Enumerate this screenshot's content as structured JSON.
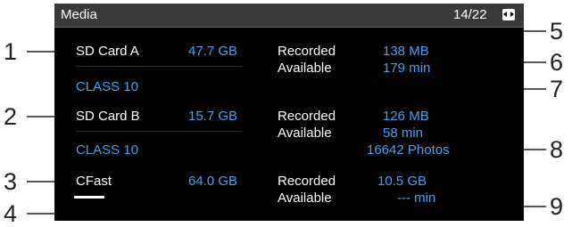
{
  "header": {
    "title": "Media",
    "page": "14/22",
    "nav_icon": "page-arrows-icon"
  },
  "media": [
    {
      "name": "SD Card A",
      "capacity": "47.7 GB",
      "class": "CLASS 10",
      "recorded_label": "Recorded",
      "recorded": "138 MB",
      "available_label": "Available",
      "available": "179 min"
    },
    {
      "name": "SD Card B",
      "capacity": "15.7 GB",
      "class": "CLASS 10",
      "recorded_label": "Recorded",
      "recorded": "126 MB",
      "available_label": "Available",
      "available": "58 min",
      "photos": "16642 Photos"
    },
    {
      "name": "CFast",
      "capacity": "64.0 GB",
      "recorded_label": "Recorded",
      "recorded": "10.5 GB",
      "available_label": "Available",
      "available": "--- min"
    }
  ],
  "callouts": [
    "1",
    "2",
    "3",
    "4",
    "5",
    "6",
    "7",
    "8",
    "9"
  ],
  "colors": {
    "value_blue": "#4aa0ee",
    "background": "#000000",
    "header": "#3a3a3a"
  }
}
